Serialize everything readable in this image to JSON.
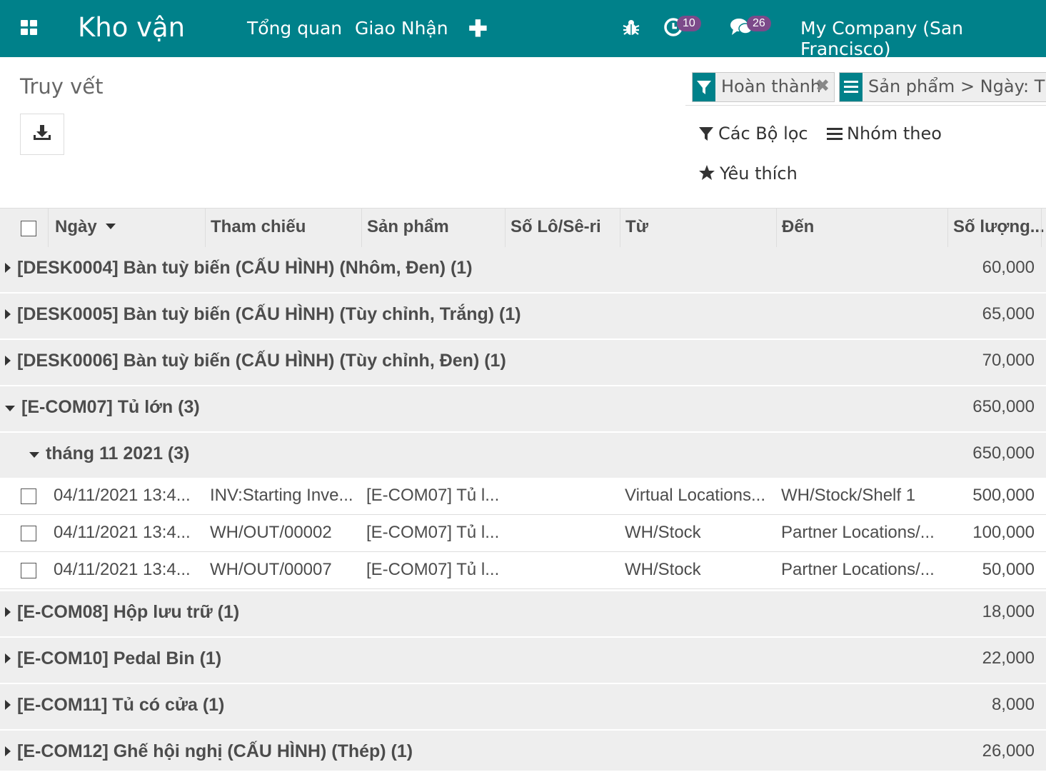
{
  "navbar": {
    "app_title": "Kho vận",
    "menu": [
      "Tổng quan",
      "Giao Nhận"
    ],
    "activity_count": "10",
    "message_count": "26",
    "company": "My Company (San Francisco)",
    "color": "#00818a"
  },
  "control": {
    "title": "Truy vết",
    "facets": [
      "Hoàn thành",
      "Sản phẩm > Ngày: Thán"
    ],
    "filters_label": "Các Bộ lọc",
    "groupby_label": "Nhóm theo",
    "favorites_label": "Yêu thích"
  },
  "columns": [
    "Ngày",
    "Tham chiếu",
    "Sản phẩm",
    "Số Lô/Sê-ri",
    "Từ",
    "Đến",
    "Số lượng..."
  ],
  "groups_before": [
    {
      "label": "[DESK0004] Bàn tuỳ biến (CẤU HÌNH) (Nhôm, Đen) (1)",
      "total": "60,000"
    },
    {
      "label": "[DESK0005] Bàn tuỳ biến (CẤU HÌNH) (Tùy chỉnh, Trắng) (1)",
      "total": "65,000"
    },
    {
      "label": "[DESK0006] Bàn tuỳ biến (CẤU HÌNH) (Tùy chỉnh, Đen) (1)",
      "total": "70,000"
    }
  ],
  "open_group": {
    "label": "[E-COM07] Tủ lớn (3)",
    "total": "650,000"
  },
  "sub_group": {
    "label": "tháng 11 2021 (3)",
    "total": "650,000"
  },
  "rows": [
    {
      "date": "04/11/2021 13:4...",
      "ref": "INV:Starting Inve...",
      "product": "[E-COM07] Tủ l...",
      "lot": "",
      "from": "Virtual Locations...",
      "to": "WH/Stock/Shelf 1",
      "qty": "500,000"
    },
    {
      "date": "04/11/2021 13:4...",
      "ref": "WH/OUT/00002",
      "product": "[E-COM07] Tủ l...",
      "lot": "",
      "from": "WH/Stock",
      "to": "Partner Locations/...",
      "qty": "100,000"
    },
    {
      "date": "04/11/2021 13:4...",
      "ref": "WH/OUT/00007",
      "product": "[E-COM07] Tủ l...",
      "lot": "",
      "from": "WH/Stock",
      "to": "Partner Locations/...",
      "qty": "50,000"
    }
  ],
  "groups_after": [
    {
      "label": "[E-COM08] Hộp lưu trữ (1)",
      "total": "18,000"
    },
    {
      "label": "[E-COM10] Pedal Bin (1)",
      "total": "22,000"
    },
    {
      "label": "[E-COM11] Tủ có cửa (1)",
      "total": "8,000"
    },
    {
      "label": "[E-COM12] Ghế hội nghị (CẤU HÌNH) (Thép) (1)",
      "total": "26,000"
    }
  ]
}
